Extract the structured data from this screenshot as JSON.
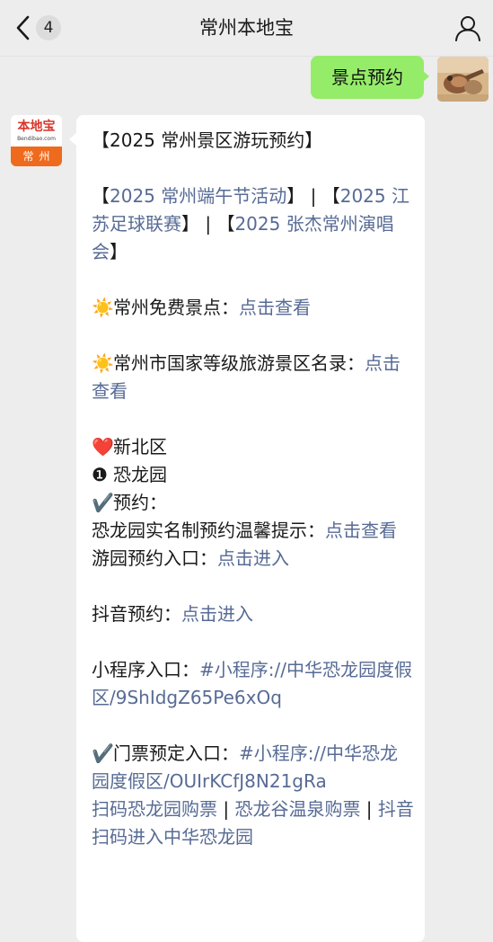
{
  "nav": {
    "unread_count": "4",
    "title": "常州本地宝"
  },
  "sent": {
    "text": "景点预约"
  },
  "account": {
    "logo": "本地宝",
    "url": "Bendibao.com",
    "city": "常州"
  },
  "reply": {
    "headline": "【2025 常州景区游玩预约】",
    "promo": {
      "bracket1_open": "【",
      "link1": "2025 常州端午节活动",
      "sep1": "】 | 【",
      "link2": "2025 江苏足球联赛",
      "sep2": "】 | 【",
      "link3": "2025 张杰常州演唱会",
      "close": "】"
    },
    "free_spots": {
      "emoji": "☀️",
      "label": "常州免费景点：",
      "link": "点击查看"
    },
    "graded_spots": {
      "emoji": "☀️",
      "label": "常州市国家等级旅游景区名录：",
      "link": "点击查看"
    },
    "district": {
      "emoji": "❤️",
      "name": "新北区"
    },
    "park": {
      "num": "❶",
      "name": "恐龙园"
    },
    "reserve": {
      "emoji": "✔️",
      "label": "预约："
    },
    "tips": {
      "label": "恐龙园实名制预约温馨提示：",
      "link": "点击查看"
    },
    "entry": {
      "label": "游园预约入口：",
      "link": "点击进入"
    },
    "douyin": {
      "label": "抖音预约：",
      "link": "点击进入"
    },
    "miniprogram": {
      "label": "小程序入口：",
      "link": "#小程序://中华恐龙园度假区/9ShIdgZ65Pe6xOq"
    },
    "tickets": {
      "emoji": "✔️",
      "label": "门票预定入口：",
      "link": "#小程序://中华恐龙园度假区/OUIrKCfJ8N21gRa",
      "scan1": "扫码恐龙园购票",
      "sep1": " | ",
      "scan2": "恐龙谷温泉购票",
      "sep2": " | ",
      "scan3": "抖音扫码进入中华恐龙园"
    }
  },
  "colors": {
    "sent_bubble": "#95ec69",
    "link": "#576b95",
    "brand_orange": "#ee6b1e"
  }
}
